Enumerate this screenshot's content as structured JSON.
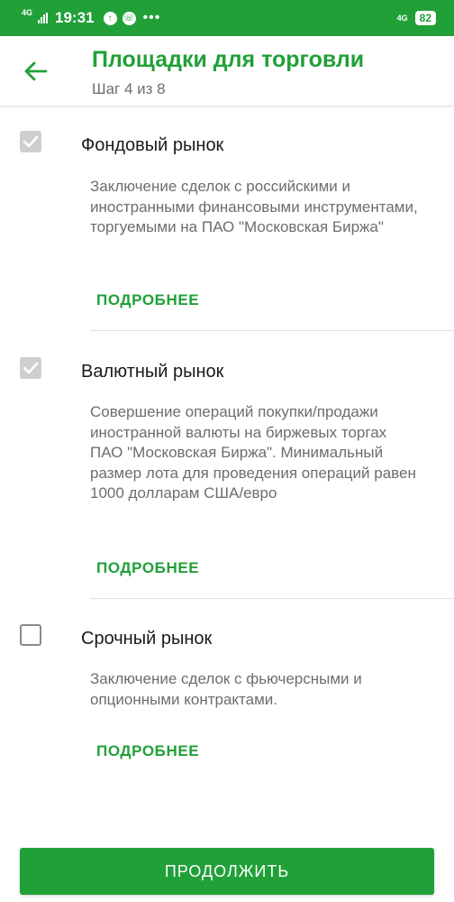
{
  "status_bar": {
    "network_left": "4G",
    "time": "19:31",
    "network_right": "4G",
    "battery": "82"
  },
  "header": {
    "title": "Площадки для торговли",
    "step": "Шаг 4 из 8"
  },
  "options": [
    {
      "title": "Фондовый рынок",
      "description": "Заключение сделок с российскими и иностранными финансовыми инструментами, торгуемыми на ПАО \"Московская Биржа\"",
      "more_label": "ПОДРОБНЕЕ",
      "checked": true
    },
    {
      "title": "Валютный рынок",
      "description": "Совершение операций покупки/продажи иностранной валюты на биржевых торгах ПАО \"Московская Биржа\". Минимальный размер лота для проведения операций равен 1000 долларам США/евро",
      "more_label": "ПОДРОБНЕЕ",
      "checked": true
    },
    {
      "title": "Срочный рынок",
      "description": "Заключение сделок с фьючерсными и опционными контрактами.",
      "more_label": "ПОДРОБНЕЕ",
      "checked": false
    }
  ],
  "continue_label": "ПРОДОЛЖИТЬ",
  "colors": {
    "brand": "#21a038",
    "checkbox_checked": "#cfcfcf",
    "text_secondary": "#6d6d6d"
  },
  "icons": {
    "back": "arrow-left-icon",
    "check": "check-icon"
  }
}
